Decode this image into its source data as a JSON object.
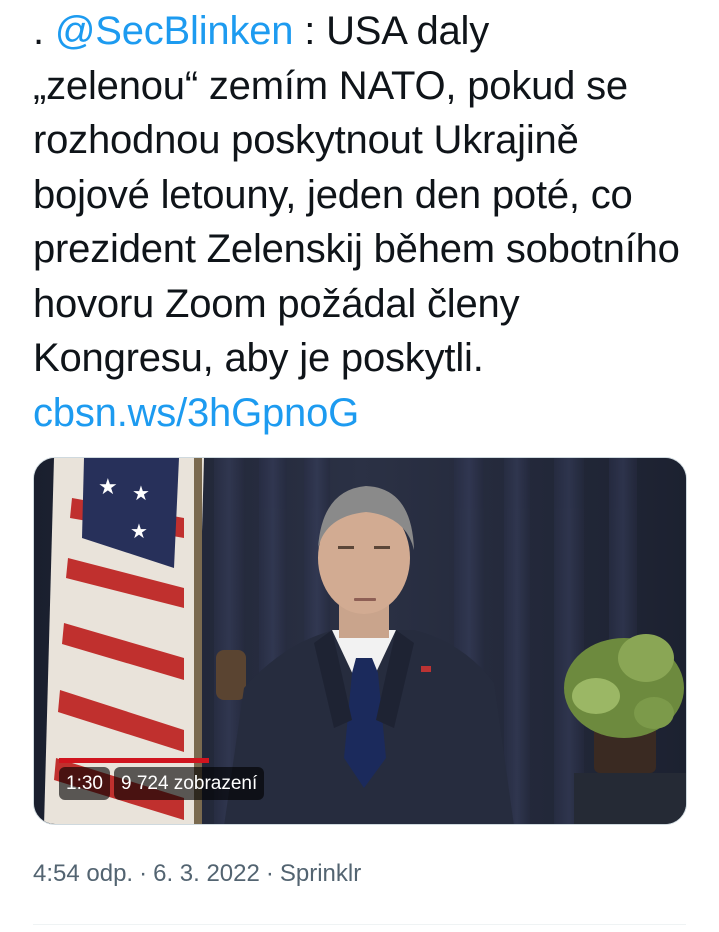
{
  "tweet": {
    "lead": ". ",
    "mention": "@SecBlinken",
    "body_line1": " : USA daly",
    "body_rest": "„zelenou“ zemím NATO, pokud se rozhodnou poskytnout Ukrajině bojové letouny, jeden den poté, co prezident Zelenskij během sobotního hovoru Zoom požádal členy Kongresu, aby je poskytli. ",
    "link": "cbsn.ws/3hGpnoG"
  },
  "video": {
    "duration": "1:30",
    "views": "9 724 zobrazení"
  },
  "meta": {
    "time": "4:54 odp.",
    "separator": "·",
    "date": "6. 3. 2022",
    "source": "Sprinklr"
  },
  "colors": {
    "link": "#1d9bf0",
    "secondary_text": "#536471",
    "text": "#0f1419"
  }
}
